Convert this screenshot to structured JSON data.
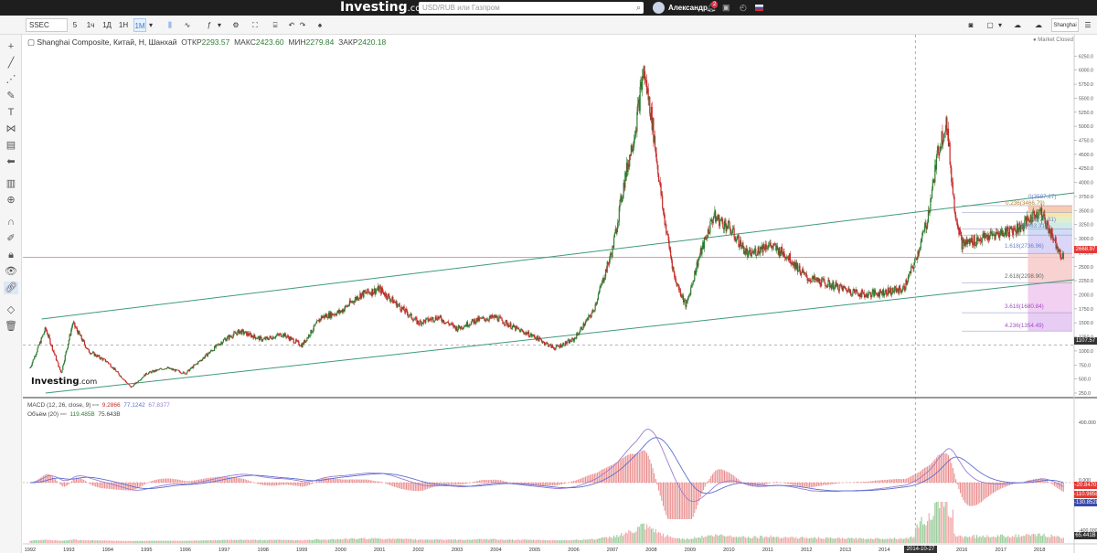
{
  "topbar": {
    "logo": "Investing",
    "logo_suffix": ".com",
    "search_placeholder": "USD/RUB или Газпром",
    "username": "Александр",
    "notification_count": "2"
  },
  "toolbar": {
    "symbol": "SSEC",
    "timeframes": [
      "5",
      "1ч",
      "1Д",
      "1Н",
      "1М"
    ],
    "selected_timeframe": "1М",
    "exchange_button": "Shanghai"
  },
  "legend": {
    "title": "Shanghai Composite, Китай, Н, Шанхай",
    "open_label": "ОТКР",
    "open": "2293.57",
    "high_label": "МАКС",
    "high": "2423.60",
    "low_label": "МИН",
    "low": "2279.84",
    "close_label": "ЗАКР",
    "close": "2420.18",
    "market_status": "Market Closed"
  },
  "macd_legend": {
    "name": "MACD (12, 26, close, 9)",
    "v1": "9.2866",
    "v2": "77.1242",
    "v3": "67.8377"
  },
  "volume_legend": {
    "name": "Объём (20)",
    "v1": "119.485B",
    "v2": "75.643B"
  },
  "watermark": {
    "text": "Investing",
    "suffix": ".com"
  },
  "price_tags": {
    "current": "2668.97",
    "horizontal": "1107.57",
    "macd_a": "-20.8470",
    "macd_b": "-110.9858",
    "macd_c": "-130.8528",
    "volume": "65.441B"
  },
  "cursor_date": "2014-10-27",
  "fib_levels": [
    {
      "label": "0(3587.27)"
    },
    {
      "label": "0.236(3466.79)"
    },
    {
      "label": "(3176.31)"
    },
    {
      "label": "(3063.31)"
    },
    {
      "label": "1.618(2736.96)"
    },
    {
      "label": "2.618(2208.90)"
    },
    {
      "label": "3.618(1680.84)"
    },
    {
      "label": "4.236(1354.49)"
    }
  ],
  "colors": {
    "up": "#2e7d32",
    "down": "#c62828",
    "channel": "#3f9a7b",
    "macd": "#9b7dcf",
    "signal": "#5b6fd3",
    "hist": "#e57373",
    "volume": "#9ccc9c",
    "current_line": "#e57373"
  },
  "chart_data": {
    "type": "line",
    "title": "Shanghai Composite, Китай, Н, Шанхай",
    "x": [
      1992.0,
      1992.4,
      1992.8,
      1993.1,
      1993.5,
      1994.0,
      1994.6,
      1995.0,
      1995.5,
      1996.0,
      1996.5,
      1997.0,
      1997.4,
      1998.0,
      1998.5,
      1999.0,
      1999.5,
      2000.0,
      2000.5,
      2001.0,
      2001.5,
      2002.0,
      2002.5,
      2003.0,
      2003.5,
      2004.0,
      2004.5,
      2005.0,
      2005.5,
      2006.0,
      2006.5,
      2007.0,
      2007.3,
      2007.6,
      2007.8,
      2008.0,
      2008.3,
      2008.6,
      2008.9,
      2009.2,
      2009.6,
      2010.0,
      2010.5,
      2011.0,
      2011.5,
      2012.0,
      2012.5,
      2013.0,
      2013.5,
      2014.0,
      2014.5,
      2014.8,
      2015.1,
      2015.4,
      2015.6,
      2015.8,
      2016.0,
      2016.5,
      2017.0,
      2017.5,
      2018.0,
      2018.3,
      2018.6
    ],
    "y": [
      700,
      1400,
      600,
      1500,
      1000,
      800,
      350,
      600,
      700,
      600,
      900,
      1200,
      1350,
      1200,
      1300,
      1100,
      1600,
      1700,
      2000,
      2100,
      1800,
      1500,
      1600,
      1400,
      1550,
      1600,
      1400,
      1250,
      1050,
      1200,
      1700,
      2800,
      4000,
      5000,
      6000,
      5200,
      3500,
      2300,
      1800,
      2600,
      3400,
      3200,
      2700,
      2900,
      2700,
      2300,
      2200,
      2100,
      2000,
      2050,
      2100,
      2600,
      3300,
      4600,
      5100,
      3600,
      2900,
      3000,
      3100,
      3200,
      3500,
      3100,
      2668
    ]
  }
}
